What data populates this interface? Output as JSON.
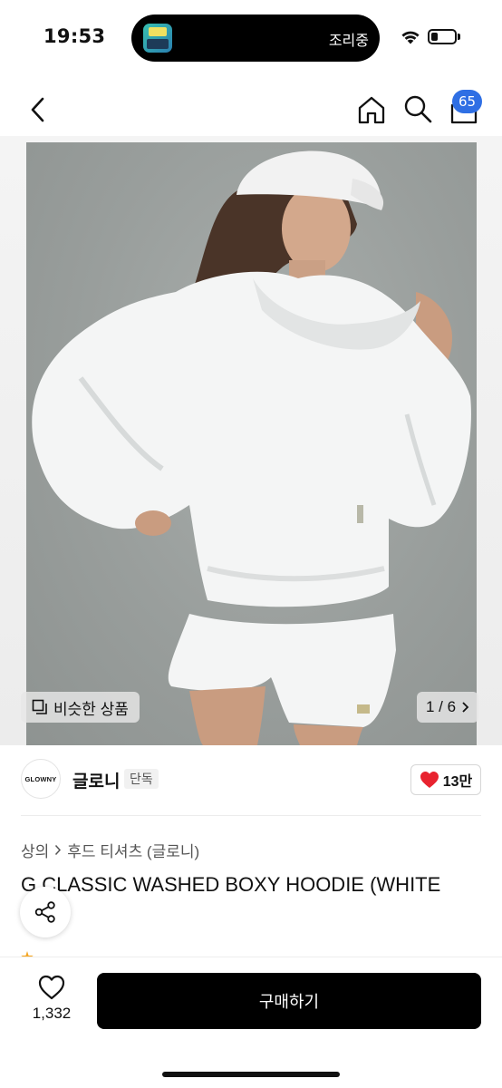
{
  "status_bar": {
    "time": "19:53",
    "live_activity": "조리중",
    "icons": [
      "app-thumbnail-icon",
      "wifi-icon",
      "battery-icon"
    ]
  },
  "header": {
    "icons": [
      "back-arrow-icon",
      "home-icon",
      "search-icon",
      "shopping-bag-icon"
    ],
    "cart_count": "65"
  },
  "gallery": {
    "similar_label": "비슷한 상품",
    "page_indicator": "1 / 6",
    "image_subject": "model wearing white hoodie, white shorts and white cap"
  },
  "brand": {
    "logo_text": "GLOWNY",
    "name": "글로니",
    "tag": "단독",
    "likes": "13만"
  },
  "product": {
    "breadcrumb": [
      "상의",
      "후드 티셔츠 (글로니)"
    ],
    "title": "G CLASSIC WASHED BOXY HOODIE (WHITE",
    "title_continued": ")"
  },
  "bottom_bar": {
    "favorite_count": "1,332",
    "buy_label": "구매하기"
  },
  "colors": {
    "badge": "#2f6fe4",
    "heart": "#e8232f",
    "buy_button": "#000000"
  }
}
